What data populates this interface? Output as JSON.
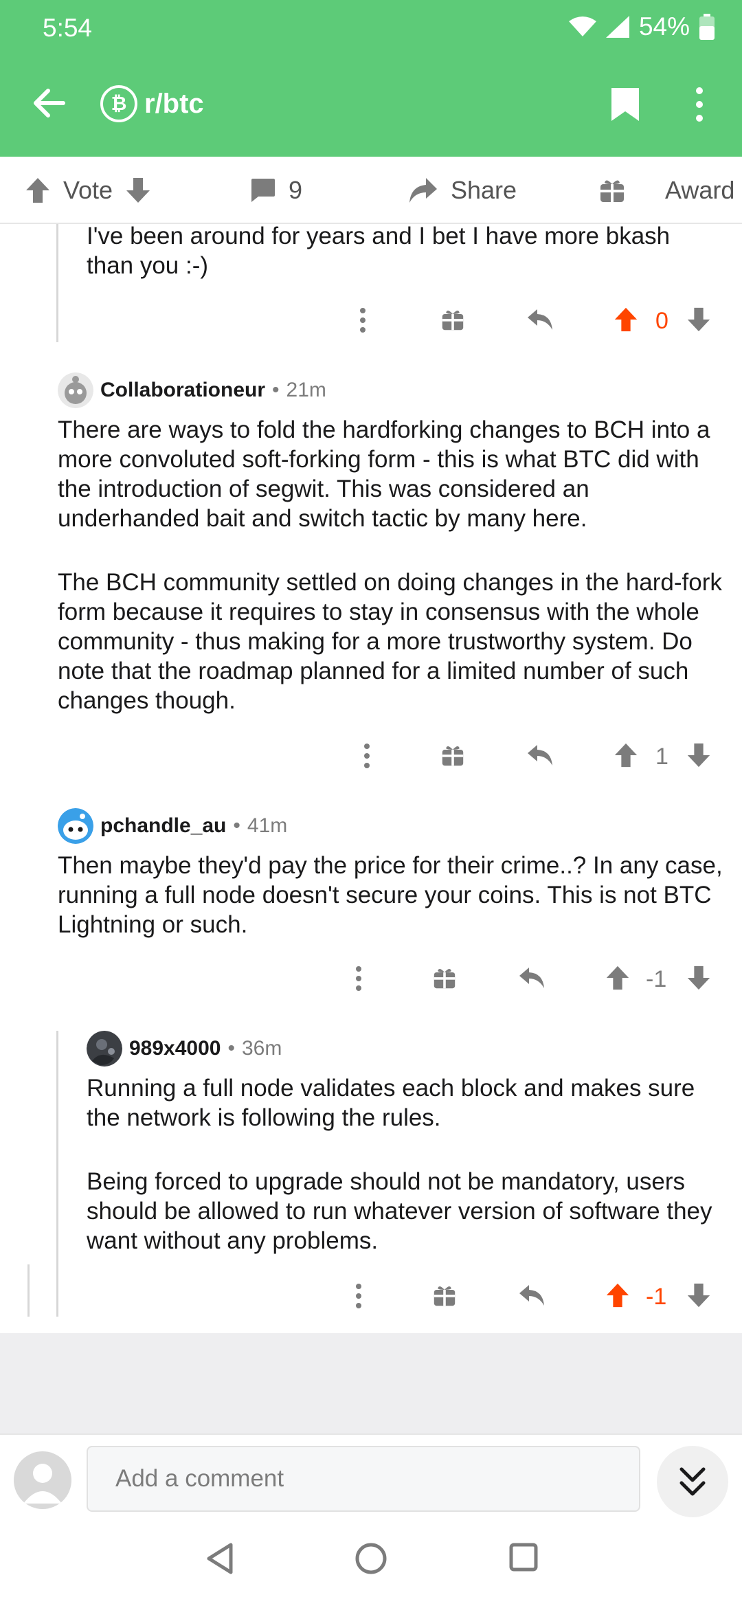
{
  "status": {
    "time": "5:54",
    "battery": "54%"
  },
  "appbar": {
    "subreddit": "r/btc",
    "sub_icon_glyph": "₿"
  },
  "actions": {
    "vote": "Vote",
    "comments": "9",
    "share": "Share",
    "award": "Award"
  },
  "comments": [
    {
      "text": "I've been around for years and I bet I have more bkash than you :-)",
      "score": "0",
      "score_color": "#ff4500",
      "upvoted": true
    },
    {
      "user": "Collaborationeur",
      "time": "21m",
      "paragraphs": [
        "There are ways to fold the hardforking changes to BCH into a more convoluted soft-forking form - this is what BTC did with the introduction of segwit. This was considered an underhanded bait and switch tactic by many here.",
        "The BCH community settled on doing changes in the hard-fork form because it requires to stay in consensus with the whole community - thus making for a more trustworthy system. Do note that the roadmap planned for a limited number of such changes though."
      ],
      "score": "1",
      "upvoted": false
    },
    {
      "user": "pchandle_au",
      "time": "41m",
      "paragraphs": [
        "Then maybe they'd pay the price for their crime..? In any case, running a full node doesn't secure your coins. This is not BTC Lightning or such."
      ],
      "score": "-1",
      "upvoted": false
    },
    {
      "user": "989x4000",
      "time": "36m",
      "paragraphs": [
        "Running a full node validates each block and makes sure the network is following the rules.",
        "Being forced to upgrade should not be mandatory, users should be allowed to run whatever version of software they want without any problems."
      ],
      "score": "-1",
      "score_color": "#ff4500",
      "upvoted": true
    }
  ],
  "composer": {
    "placeholder": "Add a comment"
  },
  "colors": {
    "header": "#5dcb78",
    "upvote": "#ff4500",
    "icon_gray": "#7c7c7c"
  }
}
